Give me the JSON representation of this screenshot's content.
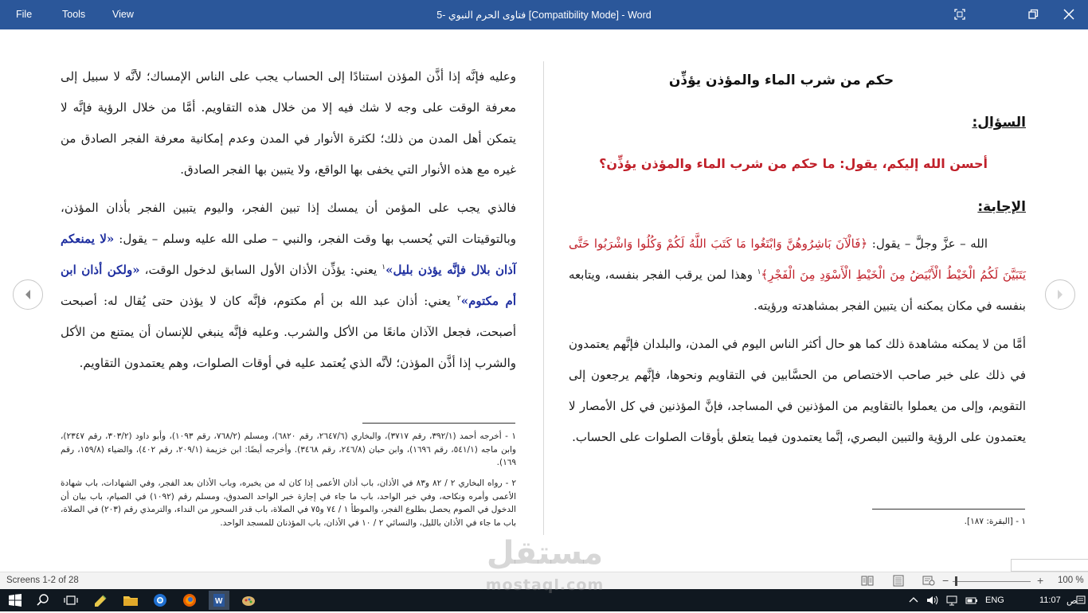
{
  "window": {
    "menu": [
      "File",
      "Tools",
      "View"
    ],
    "title": "فتاوى الحرم النبوي -5 [Compatibility Mode] - Word"
  },
  "left_page": {
    "para1": "وعليه فإنَّه إذا أذَّن المؤذن استنادًا إلى الحساب يجب على الناس الإمساك؛ لأنَّه لا سبيل إلى معرفة الوقت على وجه لا شك فيه إلا من خلال هذه التقاويم. أمَّا من خلال الرؤية فإنَّه لا يتمكن أهل المدن من ذلك؛ لكثرة الأنوار في المدن وعدم إمكانية معرفة الفجر الصادق من غيره مع هذه الأنوار التي يخفى بها الواقع، ولا يتبين بها الفجر الصادق.",
    "para2_a": "فالذي يجب على المؤمن أن يمسك إذا تبين الفجر، واليوم يتبين الفجر بأذان المؤذن، وبالتوقيتات التي يُحسب بها وقت الفجر، والنبي – صلى الله عليه وسلم – يقول: ",
    "hadith1": "«لا يمنعكم آذان بلال فإنَّه يؤذن بليل»",
    "fn_ref1": "١",
    "para2_b": " يعني: يؤذِّن الأذان الأول السابق لدخول الوقت، ",
    "hadith2": "«ولكن أذان ابن أم مكتوم»",
    "fn_ref2": "٢",
    "para2_c": " يعني: أذان عبد الله بن أم مكتوم، فإنَّه كان لا يؤذن حتى يُقال له: أصبحت أصبحت، فجعل الآذان مانعًا من الأكل والشرب. وعليه فإنَّه ينبغي للإنسان أن يمتنع من الأكل والشرب إذا أذَّن المؤذن؛ لأنَّه الذي يُعتمد عليه في أوقات الصلوات، وهم يعتمدون التقاويم.",
    "footnote1": "١ - أخرجه أحمد (٣٩٢/١، رقم ٣٧١٧)، والبخاري (٢٦٤٧/٦، رقم ٦٨٢٠)، ومسلم (٧٦٨/٢، رقم ١٠٩٣)، وأبو داود (٣٠٣/٢، رقم ٢٣٤٧)، وابن ماجه (٥٤١/١، رقم ١٦٩٦)، وابن حبان (٢٤٦/٨، رقم ٣٤٦٨). وأخرجه أيضًا: ابن خزيمة (٢٠٩/١، رقم ٤٠٢)، والضياء (١٥٩/٨، رقم ١٦٩).",
    "footnote2": "٢ - رواه البخاري ٢ / ٨٢ و٨٣ في الأذان، باب أذان الأعمى إذا كان له من يخبره، وباب الأذان بعد الفجر، وفي الشهادات، باب شهادة الأعمى وأمره ونكاحه، وفي خبر الواحد، باب ما جاء في إجازة خبر الواحد الصدوق، ومسلم رقم (١٠٩٢) في الصيام، باب بيان أن الدخول في الصوم يحصل بطلوع الفجر، والموطأ ١ / ٧٤ و٧٥ في الصلاة، باب قدر السحور من النداء، والترمذي رقم (٢٠٣) في الصلاة، باب ما جاء في الأذان بالليل، والنسائي ٢ / ١٠ في الأذان، باب المؤذنان للمسجد الواحد."
  },
  "right_page": {
    "heading": "حكم من شرب الماء والمؤذن يؤذِّن",
    "question_label": "السؤال:",
    "question": "أحسن الله إليكم، يقول: ما حكم من شرب الماء والمؤذن يؤذِّن؟",
    "answer_label": "الإجابة:",
    "answer_a": "الله – عزَّ وجلَّ – يقول: ",
    "verse": "﴿فَالْآنَ بَاشِرُوهُنَّ وَابْتَغُوا مَا كَتَبَ اللَّهُ لَكُمْ وَكُلُوا وَاشْرَبُوا حَتَّى يَتَبَيَّنَ لَكُمُ الْخَيْطُ الْأَبْيَضُ مِنَ الْخَيْطِ الْأَسْوَدِ مِنَ الْفَجْرِ﴾",
    "fn_ref1": "١",
    "answer_b": " وهذا لمن يرقب الفجر بنفسه، ويتابعه بنفسه في مكان يمكنه أن يتبين الفجر بمشاهدته ورؤيته.",
    "para2": "أمَّا من لا يمكنه مشاهدة ذلك كما هو حال أكثر الناس اليوم في المدن، والبلدان فإنَّهم يعتمدون في ذلك على خبر صاحب الاختصاص من الحسَّابين في التقاويم ونحوها، فإنَّهم يرجعون إلى التقويم، وإلى من يعملوا بالتقاويم من المؤذنين في المساجد، فإنَّ المؤذنين في كل الأمصار لا يعتمدون على الرؤية والتبين البصري، إنَّما يعتمدون فيما يتعلق بأوقات الصلوات على الحساب.",
    "footnote1": "١ - [البقرة: ١٨٧]."
  },
  "status": {
    "screens": "Screens 1-2 of 28",
    "zoom_minus": "−",
    "zoom_plus": "+",
    "zoom": "100 %",
    "zoom_level": 0.05
  },
  "taskbar": {
    "lang": "ENG",
    "time": "11:07",
    "ampm": "ص"
  },
  "watermark": {
    "arabic": "مستقل",
    "latin": "mostaql.com"
  },
  "colors": {
    "title_bar": "#2b579a",
    "hadith_blue": "#1f2fa0",
    "quran_red": "#c0202a",
    "taskbar": "#101820"
  }
}
